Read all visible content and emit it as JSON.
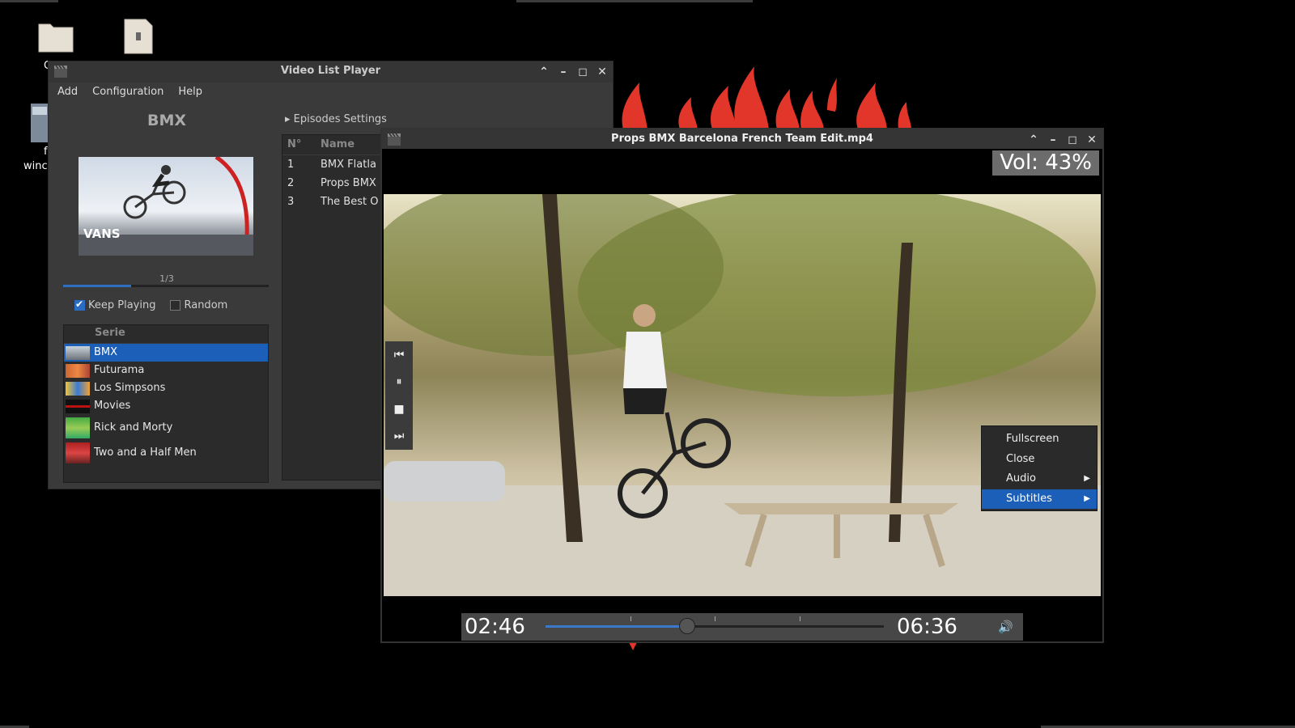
{
  "desktop": {
    "label_1": "C",
    "label_2": "f",
    "label_3": "winc"
  },
  "main_window": {
    "title": "Video List Player",
    "menu": [
      "Add",
      "Configuration",
      "Help"
    ],
    "serie_title": "BMX",
    "thumbnail_text": "VANS",
    "pager": "1/3",
    "progress_fraction": 0.33,
    "keep_playing_label": "Keep Playing",
    "keep_playing_checked": true,
    "random_label": "Random",
    "random_checked": false,
    "serie_header": "Serie",
    "series": [
      {
        "label": "BMX",
        "selected": true
      },
      {
        "label": "Futurama",
        "selected": false
      },
      {
        "label": "Los Simpsons",
        "selected": false
      },
      {
        "label": "Movies",
        "selected": false
      },
      {
        "label": "Rick and Morty",
        "selected": false
      },
      {
        "label": "Two and a Half Men",
        "selected": false
      }
    ],
    "episodes_settings": "Episodes Settings",
    "episode_columns": [
      "N°",
      "Name"
    ],
    "episodes": [
      {
        "n": "1",
        "name": "BMX Flatla"
      },
      {
        "n": "2",
        "name": "Props BMX"
      },
      {
        "n": "3",
        "name": "The Best O"
      }
    ]
  },
  "player_window": {
    "title": "Props BMX Barcelona French Team Edit.mp4",
    "volume_text": "Vol: 43%",
    "current_time": "02:46",
    "total_time": "06:36",
    "progress_fraction": 0.419
  },
  "context_menu": {
    "items": [
      {
        "label": "Fullscreen",
        "submenu": false,
        "selected": false
      },
      {
        "label": "Close",
        "submenu": false,
        "selected": false
      },
      {
        "label": "Audio",
        "submenu": true,
        "selected": false
      },
      {
        "label": "Subtitles",
        "submenu": true,
        "selected": true
      }
    ]
  },
  "colors": {
    "accent": "#1b5fb8",
    "window_bg": "#3a3a3a",
    "flame": "#e3362b"
  }
}
